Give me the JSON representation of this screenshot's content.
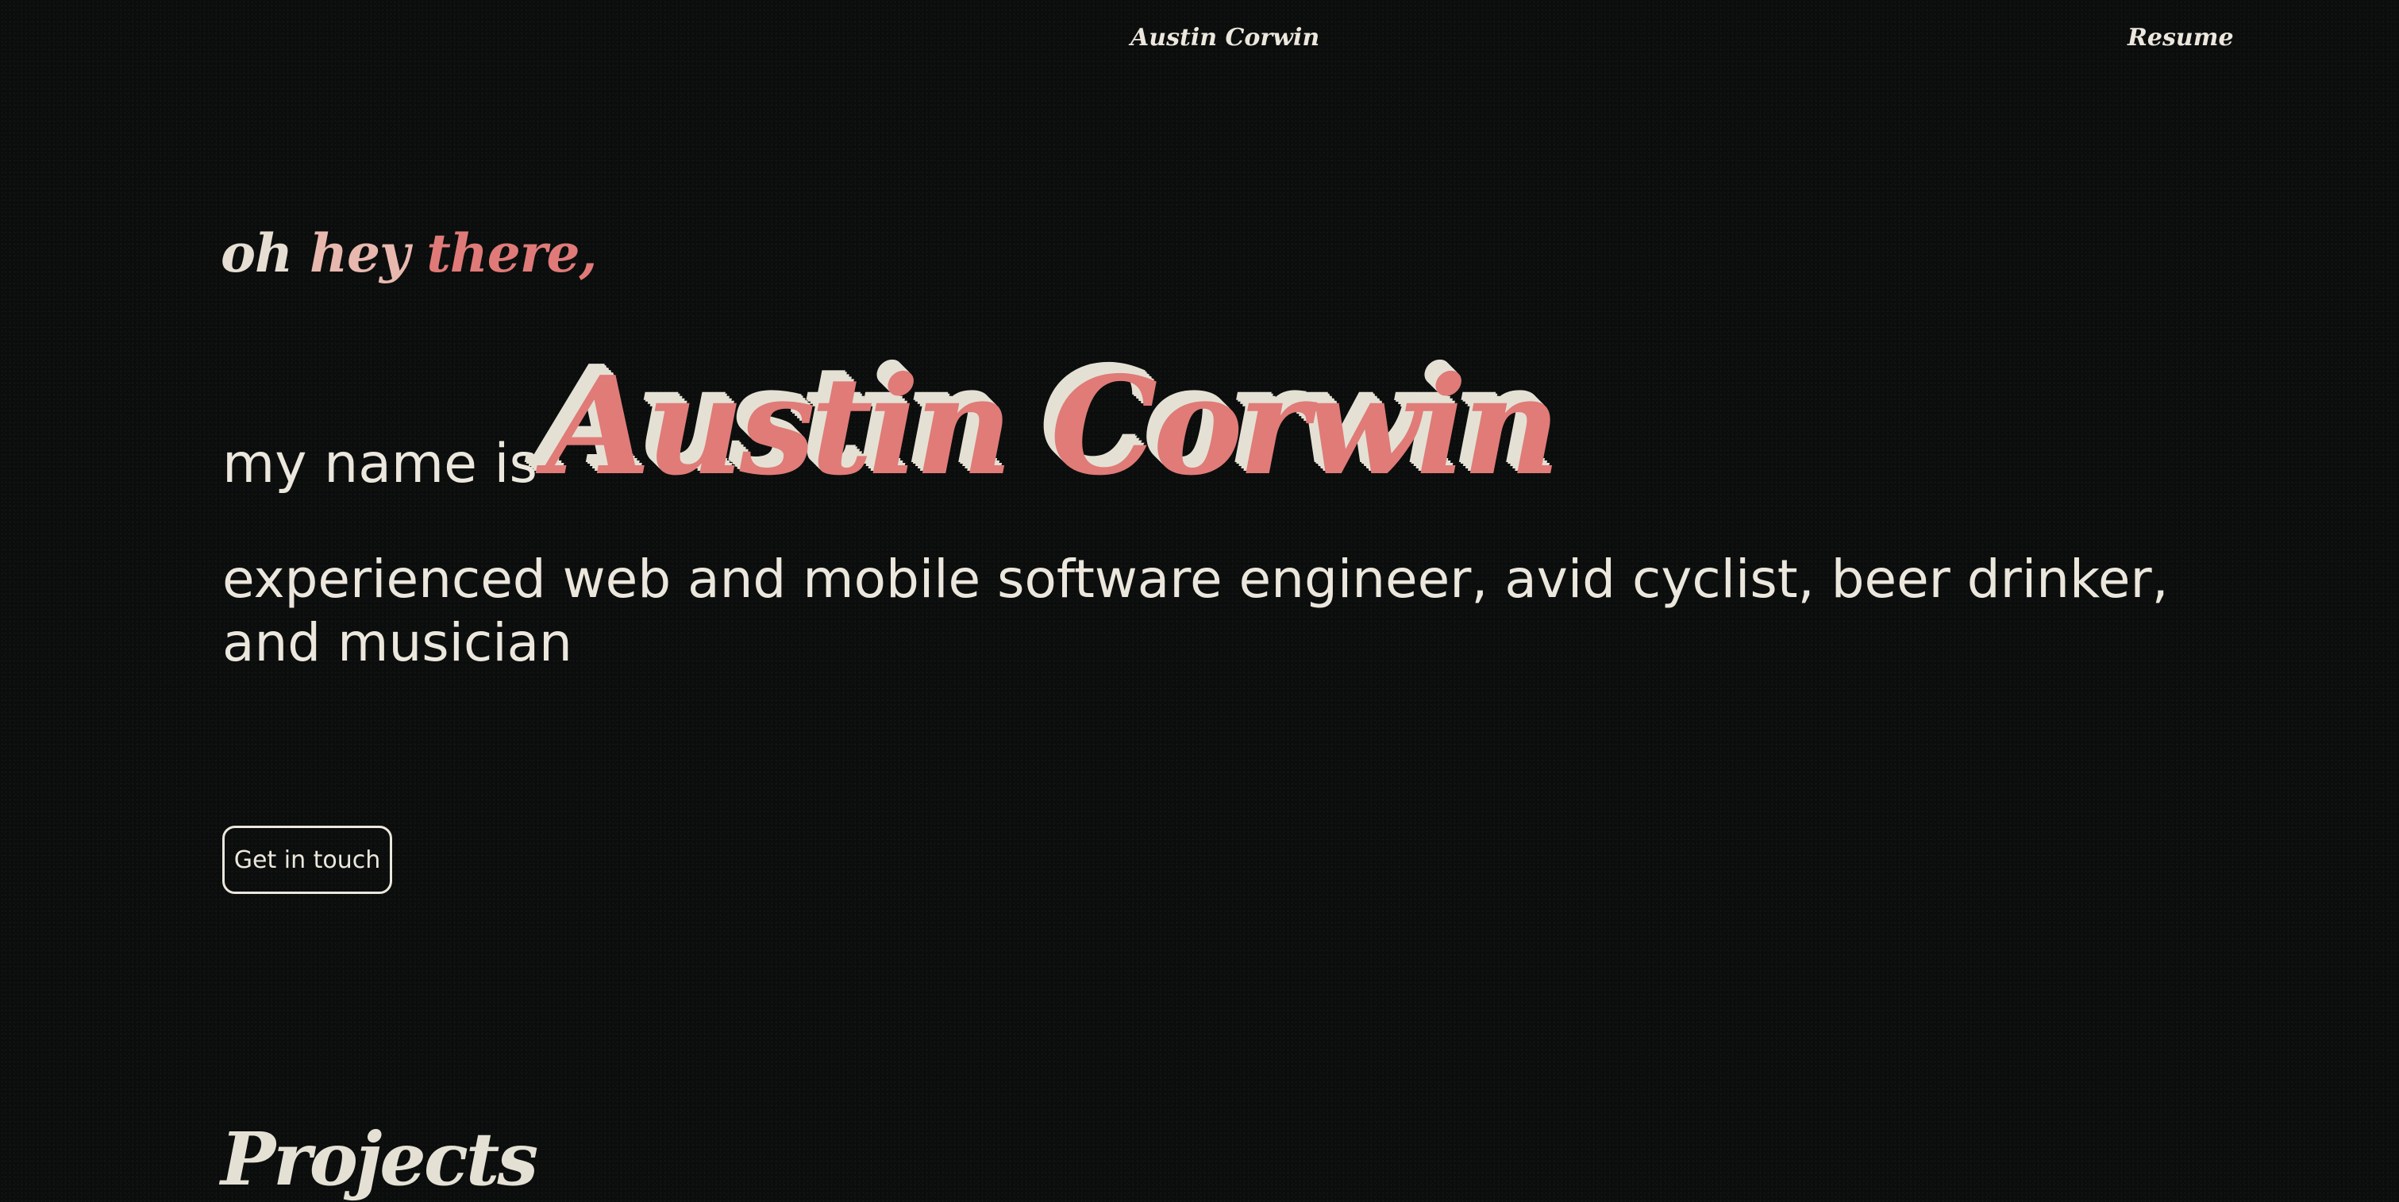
{
  "nav": {
    "brand": "Austin Corwin",
    "resume": "Resume"
  },
  "hero": {
    "greeting": [
      "oh",
      "hey",
      "there,"
    ],
    "name_intro": "my name is",
    "name": "Austin Corwin",
    "tagline": "experienced web and mobile software engineer, avid cyclist, beer drinker, and musician",
    "cta_label": "Get in touch"
  },
  "projects": {
    "title": "Projects"
  },
  "colors": {
    "background": "#0b0d0d",
    "text": "#ece7dc",
    "accent": "#e07b78",
    "accent_light": "#e8b8ae",
    "shadow": "#e4e1d4"
  }
}
